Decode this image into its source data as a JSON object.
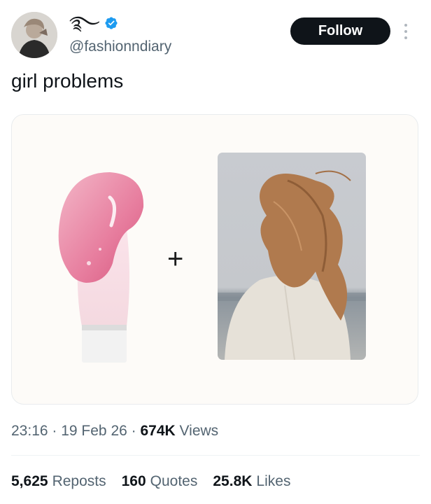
{
  "author": {
    "display_name": "࿐",
    "handle": "@fashionndiary",
    "verified_icon": "verified-badge-icon",
    "avatar_icon": "avatar-photo"
  },
  "actions": {
    "follow_label": "Follow",
    "more_icon": "more-vertical-icon"
  },
  "tweet": {
    "text": "girl problems",
    "media": {
      "left_image": "lip-gloss-applicator-image",
      "operator": "+",
      "right_image": "windblown-hair-woman-photo"
    }
  },
  "meta": {
    "time": "23:16",
    "sep1": " · ",
    "date": "19 Feb 26",
    "sep2": " · ",
    "views_count": "674K",
    "views_label": "Views"
  },
  "stats": [
    {
      "count": "5,625",
      "label": "Reposts"
    },
    {
      "count": "160",
      "label": "Quotes"
    },
    {
      "count": "25.8K",
      "label": "Likes"
    }
  ],
  "colors": {
    "text_primary": "#0f1419",
    "text_secondary": "#536471",
    "verified_blue": "#1d9bf0",
    "button_bg": "#0f1419"
  }
}
